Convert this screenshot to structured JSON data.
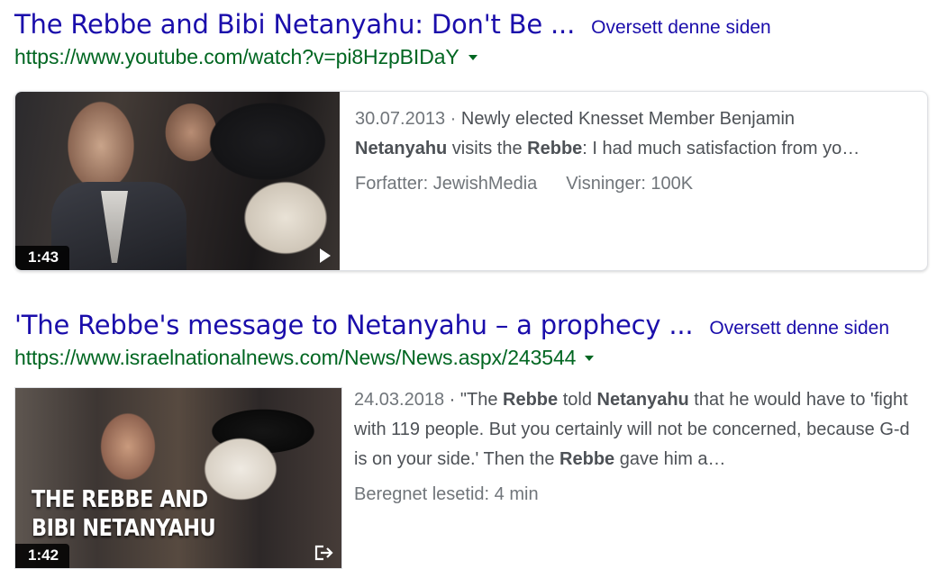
{
  "results": [
    {
      "title": "The Rebbe and Bibi Netanyahu: Don't Be ...",
      "translate": "Oversett denne siden",
      "url": "https://www.youtube.com/watch?v=pi8HzpBIDaY",
      "duration": "1:43",
      "snippet": {
        "date": "30.07.2013",
        "line1_rest": "Newly elected Knesset Member Benjamin",
        "line2_bold1": "Netanyahu",
        "line2_mid": " visits the ",
        "line2_bold2": "Rebbe",
        "line2_end": ": I had much satisfaction from yo…"
      },
      "author": "Forfatter: JewishMedia",
      "views": "Visninger: 100K"
    },
    {
      "title": "'The Rebbe's message to Netanyahu – a prophecy ...",
      "translate": "Oversett denne siden",
      "url": "https://www.israelnationalnews.com/News/News.aspx/243544",
      "duration": "1:42",
      "thumb_text_line1": "THE REBBE AND",
      "thumb_text_line2": "BIBI NETANYAHU",
      "snippet": {
        "date": "24.03.2018",
        "s1": " · \"The ",
        "b1": "Rebbe",
        "s2": " told ",
        "b2": "Netanyahu",
        "s3": " that he would have to 'fight with 119 people. But you certainly will not be concerned, because G-d is on your side.' Then the ",
        "b3": "Rebbe",
        "s4": " gave him a…"
      },
      "reading_time": "Beregnet lesetid: 4 min"
    }
  ],
  "separator": " · ",
  "icons": {
    "caret": "dropdown-caret-icon",
    "play": "play-icon",
    "exit": "external-exit-icon"
  },
  "colors": {
    "title_link": "#1a0dab",
    "url": "#006621",
    "snippet": "#4d5156",
    "meta": "#70757a"
  }
}
